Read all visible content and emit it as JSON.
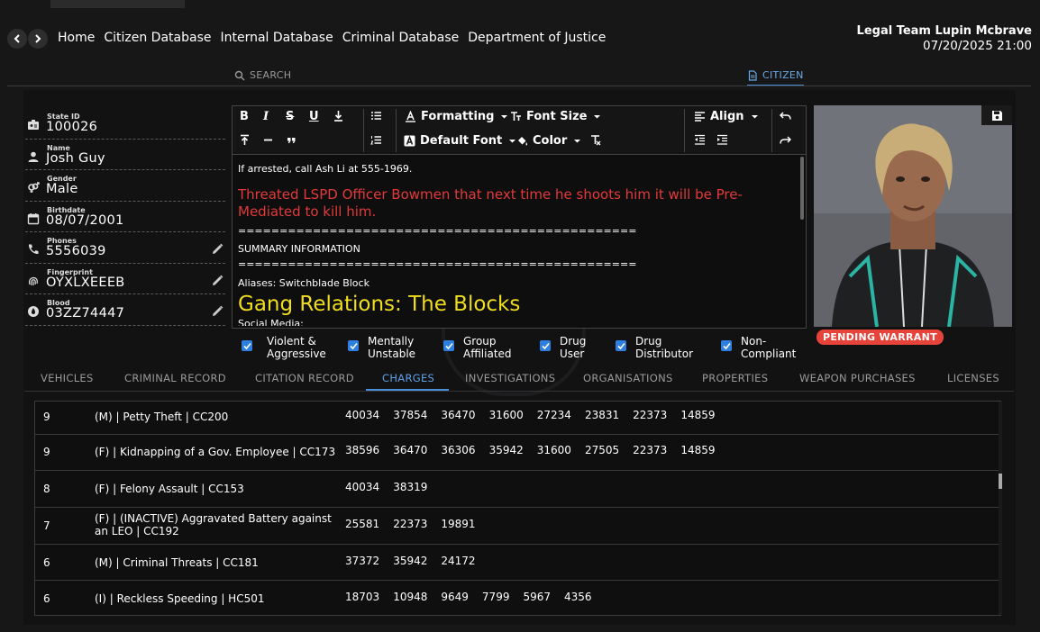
{
  "nav": {
    "back_icon": "chevron-left-icon",
    "forward_icon": "chevron-right-icon",
    "links": [
      "Home",
      "Citizen Database",
      "Internal Database",
      "Criminal Database",
      "Department of Justice"
    ]
  },
  "user": {
    "name": "Legal Team Lupin Mcbrave",
    "datetime": "07/20/2025 21:00"
  },
  "modes": {
    "search": "SEARCH",
    "citizen": "CITIZEN"
  },
  "profile": {
    "fields": [
      {
        "label": "State ID",
        "value": "100026",
        "icon": "id-card-icon"
      },
      {
        "label": "Name",
        "value": "Josh Guy",
        "icon": "person-icon"
      },
      {
        "label": "Gender",
        "value": "Male",
        "icon": "gender-icon"
      },
      {
        "label": "Birthdate",
        "value": "08/07/2001",
        "icon": "calendar-icon"
      },
      {
        "label": "Phones",
        "value": "5556039",
        "icon": "phone-icon",
        "editable": true
      },
      {
        "label": "Fingerprint",
        "value": "OYXLXEEEB",
        "icon": "fingerprint-icon",
        "editable": true
      },
      {
        "label": "Blood",
        "value": "03ZZ74447",
        "icon": "blood-drop-icon",
        "editable": true
      }
    ]
  },
  "editor": {
    "toolbar": {
      "formatting": "Formatting",
      "font_size": "Font Size",
      "align": "Align",
      "default_font": "Default Font",
      "color": "Color"
    },
    "lines": {
      "line1": "If arrested, call Ash Li at 555-1969.",
      "red": "Threated LSPD Officer Bowmen that next time he shoots him it will be Pre-Mediated to kill him.",
      "sep1": "================================================",
      "summary": "SUMMARY INFORMATION",
      "sep2": "================================================",
      "aliases": "Aliases: Switchblade Block",
      "gang": "Gang Relations: The Blocks",
      "social": "Social Media:"
    },
    "colors": {
      "red_text": "#e23a3a",
      "yellow_text": "#f0de1e"
    }
  },
  "photo": {
    "save_icon": "floppy-disk-icon"
  },
  "warrant_badge": "PENDING WARRANT",
  "flags": [
    {
      "label1": "Violent &",
      "label2": "Aggressive",
      "checked": true
    },
    {
      "label1": "Mentally",
      "label2": "Unstable",
      "checked": true
    },
    {
      "label1": "Group",
      "label2": "Affiliated",
      "checked": true
    },
    {
      "label1": "Drug",
      "label2": "User",
      "checked": true
    },
    {
      "label1": "Drug",
      "label2": "Distributor",
      "checked": true
    },
    {
      "label1": "Non-",
      "label2": "Compliant",
      "checked": true
    }
  ],
  "tabs": [
    "VEHICLES",
    "CRIMINAL RECORD",
    "CITATION RECORD",
    "CHARGES",
    "INVESTIGATIONS",
    "ORGANISATIONS",
    "PROPERTIES",
    "WEAPON PURCHASES",
    "LICENSES"
  ],
  "active_tab": "CHARGES",
  "charges": [
    {
      "count": "9",
      "charge": "(M) | Petty Theft | CC200",
      "ids": [
        "40034",
        "37854",
        "36470",
        "31600",
        "27234",
        "23831",
        "22373",
        "14859"
      ]
    },
    {
      "count": "9",
      "charge": "(F) | Kidnapping of a Gov. Employee | CC173",
      "ids": [
        "38596",
        "36470",
        "36306",
        "35942",
        "31600",
        "27505",
        "22373",
        "14859"
      ]
    },
    {
      "count": "8",
      "charge": "(F) | Felony Assault | CC153",
      "ids": [
        "40034",
        "38319"
      ]
    },
    {
      "count": "7",
      "charge": "(F) | (INACTIVE) Aggravated Battery against an LEO | CC192",
      "ids": [
        "25581",
        "22373",
        "19891"
      ]
    },
    {
      "count": "6",
      "charge": "(M) | Criminal Threats | CC181",
      "ids": [
        "37372",
        "35942",
        "24172"
      ]
    },
    {
      "count": "6",
      "charge": "(I) | Reckless Speeding | HC501",
      "ids": [
        "18703",
        "10948",
        "9649",
        "7799",
        "5967",
        "4356"
      ]
    }
  ],
  "accent_color": "#4b8ed8"
}
